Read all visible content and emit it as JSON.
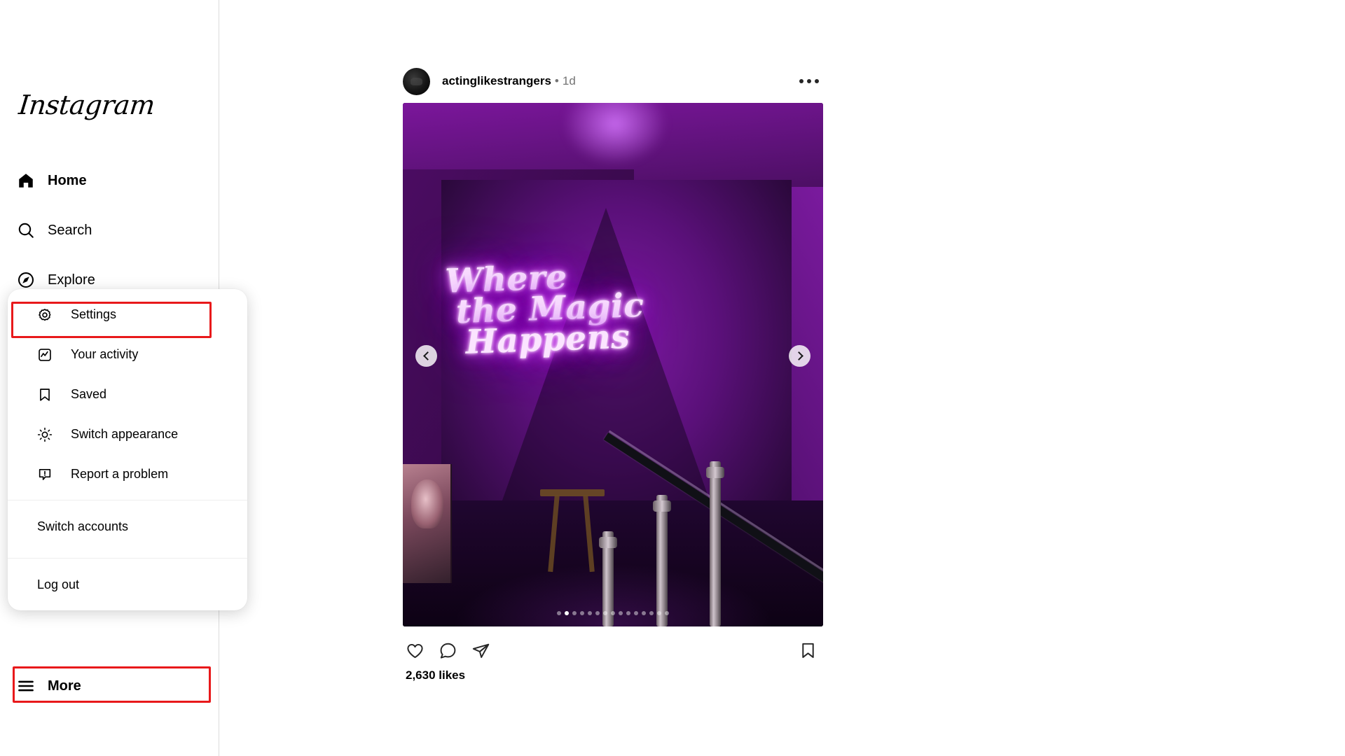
{
  "brand": {
    "name": "Instagram",
    "accent_red": "#e8191b"
  },
  "sidebar": {
    "items": [
      {
        "label": "Home",
        "icon": "home-icon",
        "active": true
      },
      {
        "label": "Search",
        "icon": "search-icon",
        "active": false
      },
      {
        "label": "Explore",
        "icon": "compass-icon",
        "active": false
      }
    ],
    "more": {
      "label": "More",
      "icon": "hamburger-icon"
    }
  },
  "menu": {
    "items": [
      {
        "label": "Settings",
        "icon": "gear-icon",
        "highlighted": true
      },
      {
        "label": "Your activity",
        "icon": "activity-icon",
        "highlighted": false
      },
      {
        "label": "Saved",
        "icon": "bookmark-icon",
        "highlighted": false
      },
      {
        "label": "Switch appearance",
        "icon": "sun-icon",
        "highlighted": false
      },
      {
        "label": "Report a problem",
        "icon": "alert-icon",
        "highlighted": false
      }
    ],
    "switch_accounts": "Switch accounts",
    "log_out": "Log out"
  },
  "post": {
    "username": "actinglikestrangers",
    "separator": "•",
    "timestamp": "1d",
    "more_options_icon": "ellipsis-icon",
    "media": {
      "neon_text_line1": "Where",
      "neon_text_line2": "the Magic",
      "neon_text_line3": "Happens",
      "carousel_total": 15,
      "carousel_active_index": 2,
      "prev_icon": "chevron-left-icon",
      "next_icon": "chevron-right-icon"
    },
    "actions": {
      "like_icon": "heart-icon",
      "comment_icon": "comment-icon",
      "share_icon": "share-icon",
      "save_icon": "bookmark-icon"
    },
    "likes_text": "2,630 likes"
  }
}
